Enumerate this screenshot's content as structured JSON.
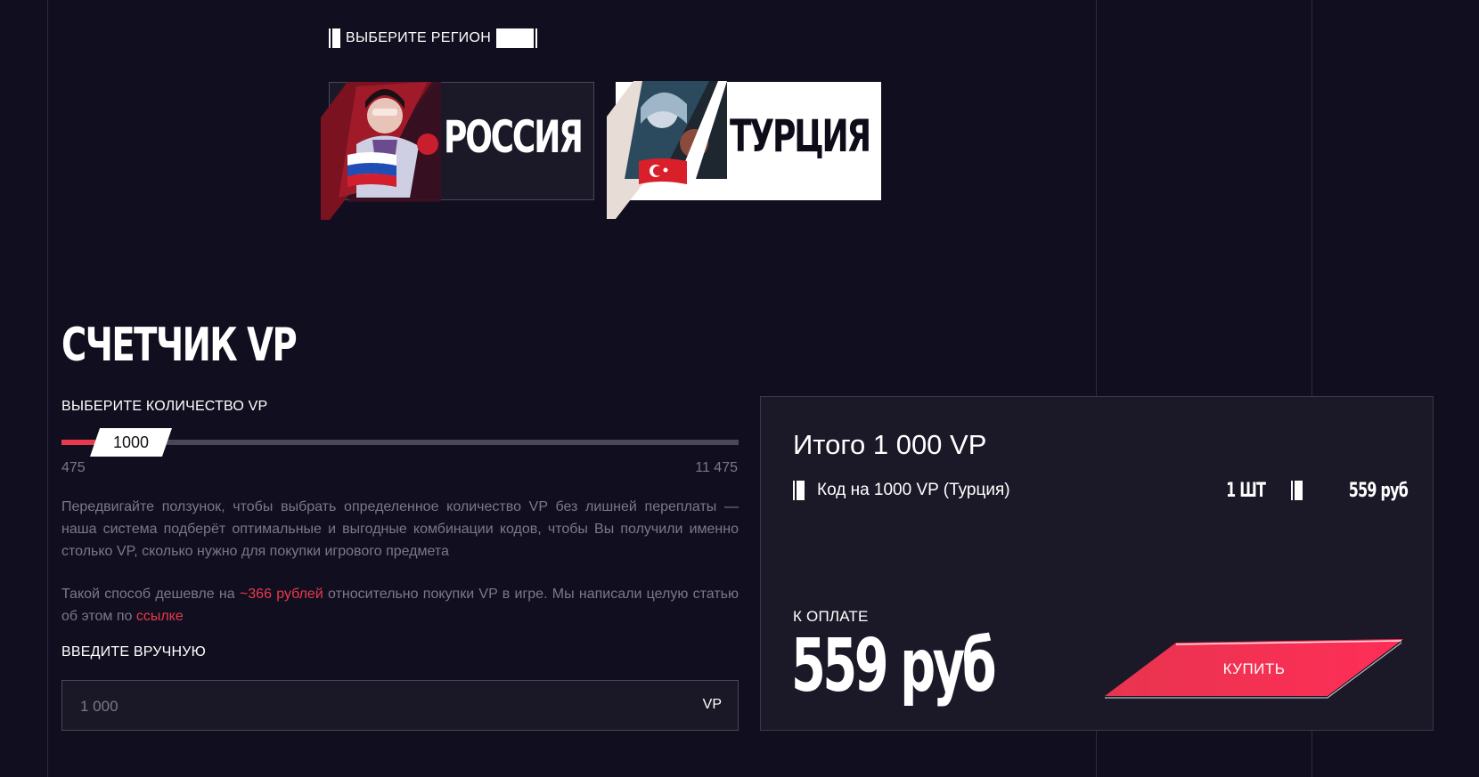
{
  "region": {
    "heading": "ВЫБЕРИТЕ РЕГИОН",
    "options": [
      {
        "name": "РОССИЯ",
        "flag": "russia-flag-icon"
      },
      {
        "name": "ТУРЦИЯ",
        "flag": "turkey-flag-icon"
      }
    ],
    "selected": "ТУРЦИЯ"
  },
  "counter": {
    "title": "СЧЕТЧИК VP",
    "choose_label": "ВЫБЕРИТЕ КОЛИЧЕСТВО VP",
    "slider": {
      "value": "1000",
      "min": "475",
      "max": "11 475",
      "level": 0.05
    },
    "description": "Передвигайте ползунок, чтобы выбрать определенное количество VP без лишней переплаты — наша система подберёт оптимальные и выгодные комбинации кодов, чтобы Вы получили именно столько VP, сколько нужно для покупки игрового предмета",
    "savings_prefix": "Такой способ дешевле на ",
    "savings_amount": "~366 рублей",
    "savings_suffix": " относительно покупки VP в игре. Мы написали целую статью об этом по ",
    "savings_link": "ссылке",
    "manual_label": "ВВЕДИТЕ ВРУЧНУЮ",
    "manual_value": "1 000",
    "manual_unit": "VP"
  },
  "summary": {
    "title": "Итого 1 000 VP",
    "line_item": {
      "label": "Код на 1000 VP (Турция)",
      "qty": "1 ШТ",
      "price": "559 руб"
    },
    "to_pay_label": "К ОПЛАТЕ",
    "total": "559 руб",
    "buy_label": "КУПИТЬ"
  },
  "colors": {
    "background": "#110f1f",
    "accent": "#e83a4c",
    "panel": "#1b1928",
    "muted": "#7b7889"
  }
}
